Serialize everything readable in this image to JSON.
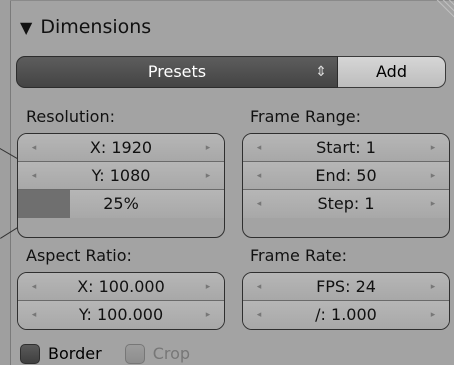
{
  "panel": {
    "title": "Dimensions",
    "collapse_icon": "triangle-down-icon"
  },
  "presets": {
    "label": "Presets",
    "add_label": "Add",
    "updown_icon": "up-down-arrows-icon"
  },
  "resolution": {
    "label": "Resolution:",
    "x": "X: 1920",
    "y": "Y: 1080",
    "percentage": "25%",
    "percentage_value": 0.25
  },
  "frame_range": {
    "label": "Frame Range:",
    "start": "Start: 1",
    "end": "End: 50",
    "step": "Step: 1"
  },
  "aspect_ratio": {
    "label": "Aspect Ratio:",
    "x": "X: 100.000",
    "y": "Y: 100.000"
  },
  "frame_rate": {
    "label": "Frame Rate:",
    "fps": "FPS: 24",
    "base": "/: 1.000"
  },
  "options": {
    "border": "Border",
    "crop": "Crop"
  },
  "icons": {
    "decrement": "◂",
    "increment": "▸",
    "collapse": "▼",
    "updown": "⇕"
  }
}
